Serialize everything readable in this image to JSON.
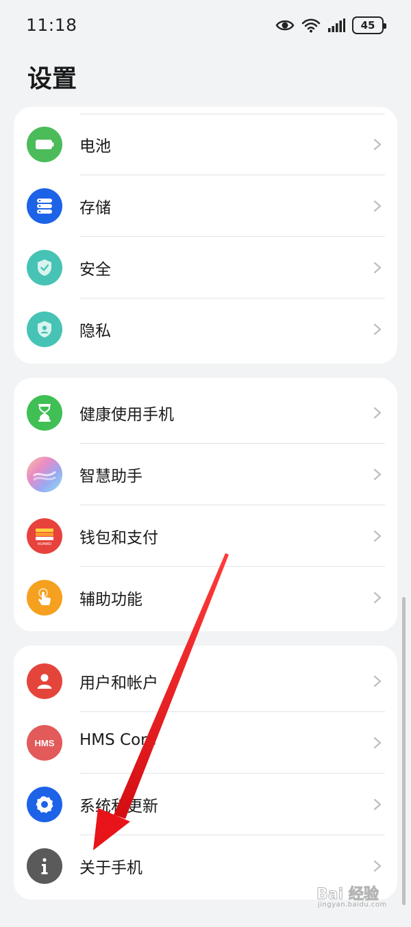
{
  "status_bar": {
    "time": "11:18",
    "battery": "45",
    "icons": [
      "eye-icon",
      "wifi-icon",
      "signal-icon",
      "battery-icon"
    ]
  },
  "page_title": "设置",
  "groups": [
    {
      "items": [
        {
          "label": "电池",
          "icon": "battery-icon",
          "color": "#4cbb5a"
        },
        {
          "label": "存储",
          "icon": "storage-icon",
          "color": "#1d63e8"
        },
        {
          "label": "安全",
          "icon": "shield-check-icon",
          "color": "#46c3b4"
        },
        {
          "label": "隐私",
          "icon": "privacy-icon",
          "color": "#46c3b4"
        }
      ]
    },
    {
      "items": [
        {
          "label": "健康使用手机",
          "icon": "hourglass-icon",
          "color": "#3fbf54"
        },
        {
          "label": "智慧助手",
          "icon": "assistant-icon",
          "color": "#a98cf0"
        },
        {
          "label": "钱包和支付",
          "icon": "wallet-icon",
          "color": "#e8423c",
          "badge": "HUAWEI"
        },
        {
          "label": "辅助功能",
          "icon": "hand-tap-icon",
          "color": "#f5a01e"
        }
      ]
    },
    {
      "items": [
        {
          "label": "用户和帐户",
          "icon": "user-icon",
          "color": "#e4453b"
        },
        {
          "label": "HMS Core",
          "icon": "hms-icon",
          "color": "#e25a5a",
          "badge": "HMS"
        },
        {
          "label": "系统和更新",
          "icon": "gear-icon",
          "color": "#1d63e8"
        },
        {
          "label": "关于手机",
          "icon": "info-icon",
          "color": "#5a5a5a"
        }
      ]
    }
  ],
  "watermark": {
    "brand": "Bai 经验",
    "url": "jingyan.baidu.com"
  },
  "colors": {
    "background": "#f1f3f5",
    "card": "#ffffff",
    "arrow": "#e8141a",
    "chevron": "#bdbdbd"
  }
}
